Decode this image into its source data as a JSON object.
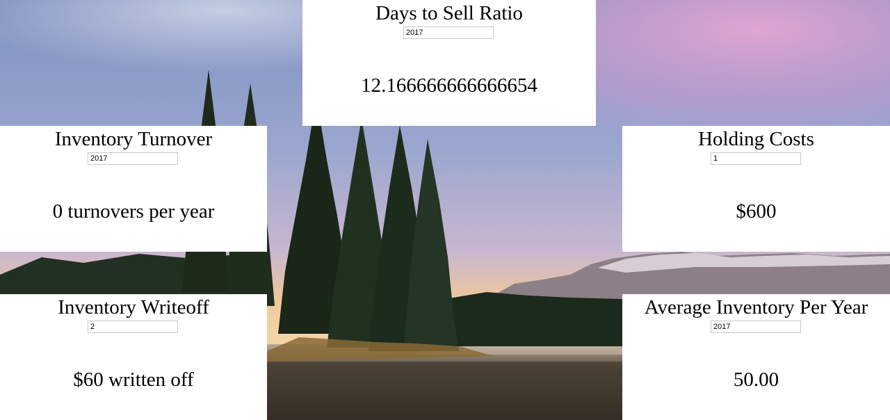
{
  "background": {
    "description_colors": {
      "sky_top": "#7d8fbf",
      "sky_pink": "#d9a3c9",
      "horizon_glow": "#f2c48a",
      "forest": "#1d2a1c",
      "lake": "#3a3530"
    }
  },
  "cards": {
    "days_to_sell": {
      "title": "Days to Sell Ratio",
      "input_value": "2017",
      "result": "12.166666666666654"
    },
    "inventory_turnover": {
      "title": "Inventory Turnover",
      "input_value": "2017",
      "result": "0 turnovers per year"
    },
    "holding_costs": {
      "title": "Holding Costs",
      "input_value": "1",
      "result": "$600"
    },
    "inventory_writeoff": {
      "title": "Inventory Writeoff",
      "input_value": "2",
      "result": "$60 written off"
    },
    "average_inventory": {
      "title": "Average Inventory Per Year",
      "input_value": "2017",
      "result": "50.00"
    }
  }
}
